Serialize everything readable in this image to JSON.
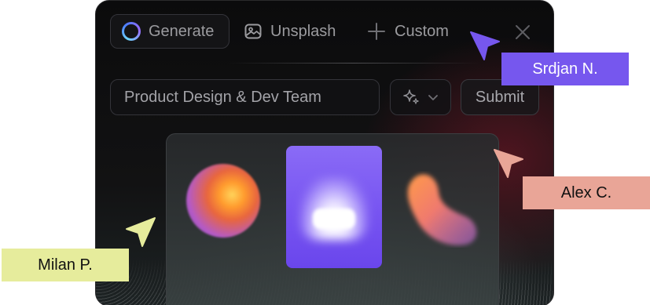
{
  "tabs": {
    "generate_label": "Generate",
    "unsplash_label": "Unsplash",
    "custom_label": "Custom"
  },
  "prompt": {
    "value": "Product Design & Dev Team"
  },
  "submit_label": "Submit",
  "collaborators": [
    {
      "name": "Srdjan N.",
      "color": "#7657ee"
    },
    {
      "name": "Alex C.",
      "color": "#e9a597"
    },
    {
      "name": "Milan P.",
      "color": "#e6ec9c"
    }
  ],
  "icons": {
    "generate": "ring-icon",
    "unsplash": "image-icon",
    "custom": "plus-icon",
    "close": "close-icon",
    "style": "sparkle-icon",
    "dropdown": "chevron-down-icon",
    "cursor": "pointer-cursor-icon"
  }
}
